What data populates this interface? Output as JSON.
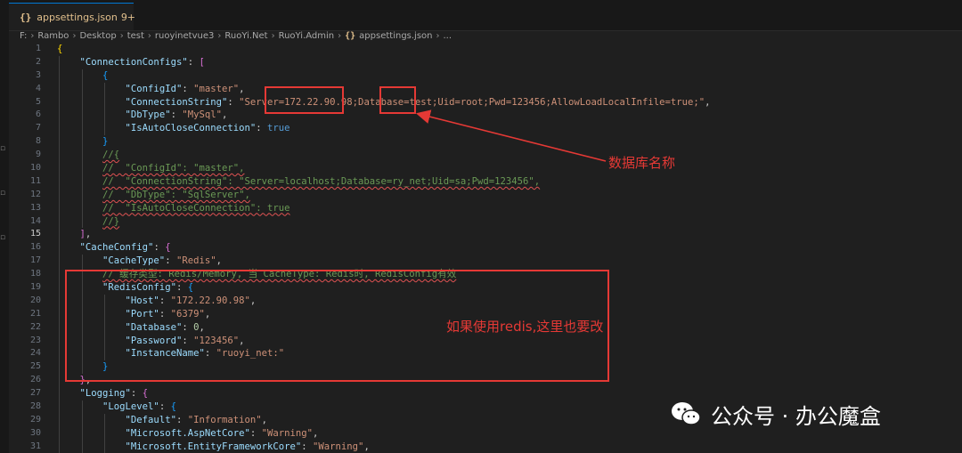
{
  "tab": {
    "icon": "{}",
    "name": "appsettings.json",
    "badge": "9+"
  },
  "breadcrumb": {
    "parts": [
      "F:",
      "Rambo",
      "Desktop",
      "test",
      "ruoyinetvue3",
      "RuoYi.Net",
      "RuoYi.Admin"
    ],
    "file_icon": "{}",
    "file": "appsettings.json",
    "tail": "..."
  },
  "editor": {
    "active_line": 15,
    "line_numbers": [
      "1",
      "2",
      "3",
      "4",
      "5",
      "6",
      "7",
      "8",
      "9",
      "10",
      "11",
      "12",
      "13",
      "14",
      "15",
      "16",
      "17",
      "18",
      "19",
      "20",
      "21",
      "22",
      "23",
      "24",
      "25",
      "26",
      "27",
      "28",
      "29",
      "30",
      "31"
    ],
    "lines": [
      [
        {
          "t": "{",
          "c": "b1"
        }
      ],
      [
        {
          "t": "    "
        },
        {
          "t": "\"ConnectionConfigs\"",
          "c": "k"
        },
        {
          "t": ": ",
          "c": "p"
        },
        {
          "t": "[",
          "c": "b2"
        }
      ],
      [
        {
          "t": "        "
        },
        {
          "t": "{",
          "c": "b3"
        }
      ],
      [
        {
          "t": "            "
        },
        {
          "t": "\"ConfigId\"",
          "c": "k"
        },
        {
          "t": ": ",
          "c": "p"
        },
        {
          "t": "\"master\"",
          "c": "s"
        },
        {
          "t": ",",
          "c": "p"
        }
      ],
      [
        {
          "t": "            "
        },
        {
          "t": "\"ConnectionString\"",
          "c": "k"
        },
        {
          "t": ": ",
          "c": "p"
        },
        {
          "t": "\"Server=172.22.90.98;Database=test;Uid=root;Pwd=123456;AllowLoadLocalInfile=true;\"",
          "c": "s"
        },
        {
          "t": ",",
          "c": "p"
        }
      ],
      [
        {
          "t": "            "
        },
        {
          "t": "\"DbType\"",
          "c": "k"
        },
        {
          "t": ": ",
          "c": "p"
        },
        {
          "t": "\"MySql\"",
          "c": "s"
        },
        {
          "t": ",",
          "c": "p"
        }
      ],
      [
        {
          "t": "            "
        },
        {
          "t": "\"IsAutoCloseConnection\"",
          "c": "k"
        },
        {
          "t": ": ",
          "c": "p"
        },
        {
          "t": "true",
          "c": "kw"
        }
      ],
      [
        {
          "t": "        "
        },
        {
          "t": "}",
          "c": "b3"
        }
      ],
      [
        {
          "t": "        "
        },
        {
          "t": "//{",
          "c": "c sq"
        }
      ],
      [
        {
          "t": "        "
        },
        {
          "t": "//  \"ConfigId\": \"master\",",
          "c": "c sq"
        }
      ],
      [
        {
          "t": "        "
        },
        {
          "t": "//  \"ConnectionString\": \"Server=localhost;Database=ry_net;Uid=sa;Pwd=123456\",",
          "c": "c sq"
        }
      ],
      [
        {
          "t": "        "
        },
        {
          "t": "//  \"DbType\": \"SqlServer\",",
          "c": "c sq"
        }
      ],
      [
        {
          "t": "        "
        },
        {
          "t": "//  \"IsAutoCloseConnection\": true",
          "c": "c sq"
        }
      ],
      [
        {
          "t": "        "
        },
        {
          "t": "//}",
          "c": "c sq"
        }
      ],
      [
        {
          "t": "    "
        },
        {
          "t": "]",
          "c": "b2"
        },
        {
          "t": ",",
          "c": "p"
        }
      ],
      [
        {
          "t": "    "
        },
        {
          "t": "\"CacheConfig\"",
          "c": "k"
        },
        {
          "t": ": ",
          "c": "p"
        },
        {
          "t": "{",
          "c": "b2"
        }
      ],
      [
        {
          "t": "        "
        },
        {
          "t": "\"CacheType\"",
          "c": "k"
        },
        {
          "t": ": ",
          "c": "p"
        },
        {
          "t": "\"Redis\"",
          "c": "s"
        },
        {
          "t": ",",
          "c": "p"
        }
      ],
      [
        {
          "t": "        "
        },
        {
          "t": "// 缓存类型: Redis/Memory, 当 CacheType: Redis时, RedisConfig有效",
          "c": "c sq"
        }
      ],
      [
        {
          "t": "        "
        },
        {
          "t": "\"RedisConfig\"",
          "c": "k"
        },
        {
          "t": ": ",
          "c": "p"
        },
        {
          "t": "{",
          "c": "b3"
        }
      ],
      [
        {
          "t": "            "
        },
        {
          "t": "\"Host\"",
          "c": "k"
        },
        {
          "t": ": ",
          "c": "p"
        },
        {
          "t": "\"172.22.90.98\"",
          "c": "s"
        },
        {
          "t": ",",
          "c": "p"
        }
      ],
      [
        {
          "t": "            "
        },
        {
          "t": "\"Port\"",
          "c": "k"
        },
        {
          "t": ": ",
          "c": "p"
        },
        {
          "t": "\"6379\"",
          "c": "s"
        },
        {
          "t": ",",
          "c": "p"
        }
      ],
      [
        {
          "t": "            "
        },
        {
          "t": "\"Database\"",
          "c": "k"
        },
        {
          "t": ": ",
          "c": "p"
        },
        {
          "t": "0",
          "c": "n"
        },
        {
          "t": ",",
          "c": "p"
        }
      ],
      [
        {
          "t": "            "
        },
        {
          "t": "\"Password\"",
          "c": "k"
        },
        {
          "t": ": ",
          "c": "p"
        },
        {
          "t": "\"123456\"",
          "c": "s"
        },
        {
          "t": ",",
          "c": "p"
        }
      ],
      [
        {
          "t": "            "
        },
        {
          "t": "\"InstanceName\"",
          "c": "k"
        },
        {
          "t": ": ",
          "c": "p"
        },
        {
          "t": "\"ruoyi_net:\"",
          "c": "s"
        }
      ],
      [
        {
          "t": "        "
        },
        {
          "t": "}",
          "c": "b3"
        }
      ],
      [
        {
          "t": "    "
        },
        {
          "t": "}",
          "c": "b2"
        },
        {
          "t": ",",
          "c": "p"
        }
      ],
      [
        {
          "t": "    "
        },
        {
          "t": "\"Logging\"",
          "c": "k"
        },
        {
          "t": ": ",
          "c": "p"
        },
        {
          "t": "{",
          "c": "b2"
        }
      ],
      [
        {
          "t": "        "
        },
        {
          "t": "\"LogLevel\"",
          "c": "k"
        },
        {
          "t": ": ",
          "c": "p"
        },
        {
          "t": "{",
          "c": "b3"
        }
      ],
      [
        {
          "t": "            "
        },
        {
          "t": "\"Default\"",
          "c": "k"
        },
        {
          "t": ": ",
          "c": "p"
        },
        {
          "t": "\"Information\"",
          "c": "s"
        },
        {
          "t": ",",
          "c": "p"
        }
      ],
      [
        {
          "t": "            "
        },
        {
          "t": "\"Microsoft.AspNetCore\"",
          "c": "k"
        },
        {
          "t": ": ",
          "c": "p"
        },
        {
          "t": "\"Warning\"",
          "c": "s"
        },
        {
          "t": ",",
          "c": "p"
        }
      ],
      [
        {
          "t": "            "
        },
        {
          "t": "\"Microsoft.EntityFrameworkCore\"",
          "c": "k"
        },
        {
          "t": ": ",
          "c": "p"
        },
        {
          "t": "\"Warning\"",
          "c": "s"
        },
        {
          "t": ",",
          "c": "p"
        }
      ]
    ]
  },
  "annotations": {
    "db_name_label": "数据库名称",
    "redis_label": "如果使用redis,这里也要改",
    "accent_color": "#e53935"
  },
  "watermark": {
    "icon": "wechat-icon",
    "text": "公众号 · 办公魔盒"
  }
}
